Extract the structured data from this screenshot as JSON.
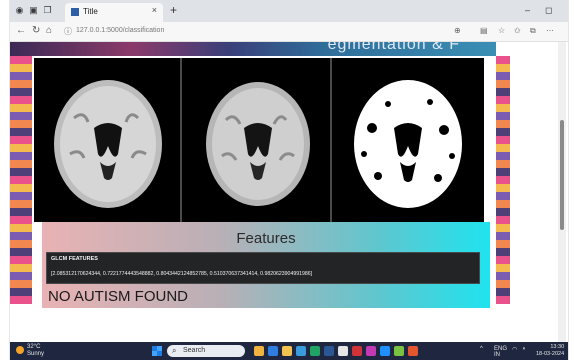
{
  "browser": {
    "tab_title": "Title",
    "url": "127.0.0.1:5000/classification"
  },
  "page": {
    "banner_text": "egmentation & F",
    "features_title": "Features",
    "glcm_heading": "GLCM FEATURES",
    "glcm_values": "[2.085312170624344, 0.7221774443548882, 0.8043442124852785, 0.510370637341414, 0.9820623904991986]",
    "result_text": "NO AUTISM FOUND"
  },
  "taskbar": {
    "weather_temp": "32°C",
    "weather_desc": "Sunny",
    "search_placeholder": "Search",
    "lang": "ENG",
    "region": "IN",
    "time": "13:30",
    "date": "18-03-2024"
  },
  "colors": {
    "features_gradient": [
      "#e9b2b4",
      "#1fe3ef"
    ],
    "glcm_bg": "#222426",
    "taskbar_bg": "#1f2740"
  }
}
